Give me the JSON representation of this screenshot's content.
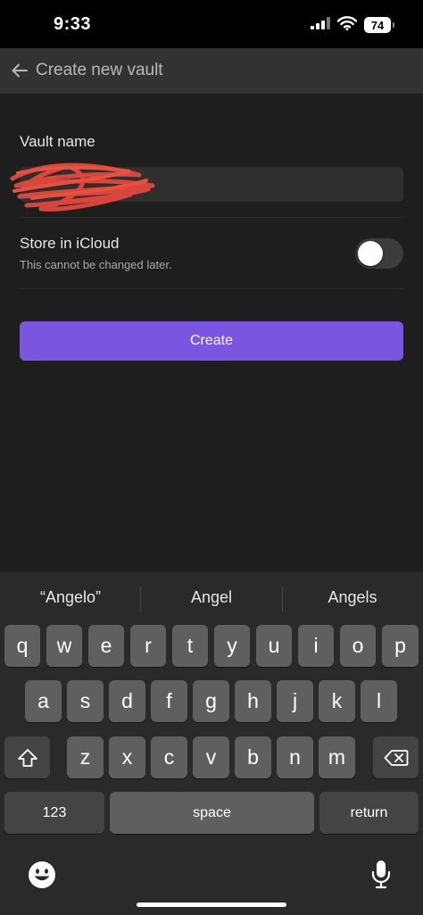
{
  "status_bar": {
    "time": "9:33",
    "battery": "74"
  },
  "header": {
    "title": "Create new vault"
  },
  "form": {
    "vault_name_label": "Vault name",
    "vault_name_value": "",
    "icloud_label": "Store in iCloud",
    "icloud_sublabel": "This cannot be changed later.",
    "icloud_enabled": false,
    "create_label": "Create"
  },
  "colors": {
    "accent": "#7a55e0",
    "background": "#1e1e1e",
    "header": "#323232"
  },
  "keyboard": {
    "suggestions": [
      "“Angelo”",
      "Angel",
      "Angels"
    ],
    "row1": [
      "q",
      "w",
      "e",
      "r",
      "t",
      "y",
      "u",
      "i",
      "o",
      "p"
    ],
    "row2": [
      "a",
      "s",
      "d",
      "f",
      "g",
      "h",
      "j",
      "k",
      "l"
    ],
    "row3": [
      "z",
      "x",
      "c",
      "v",
      "b",
      "n",
      "m"
    ],
    "numbers_label": "123",
    "space_label": "space",
    "return_label": "return"
  }
}
